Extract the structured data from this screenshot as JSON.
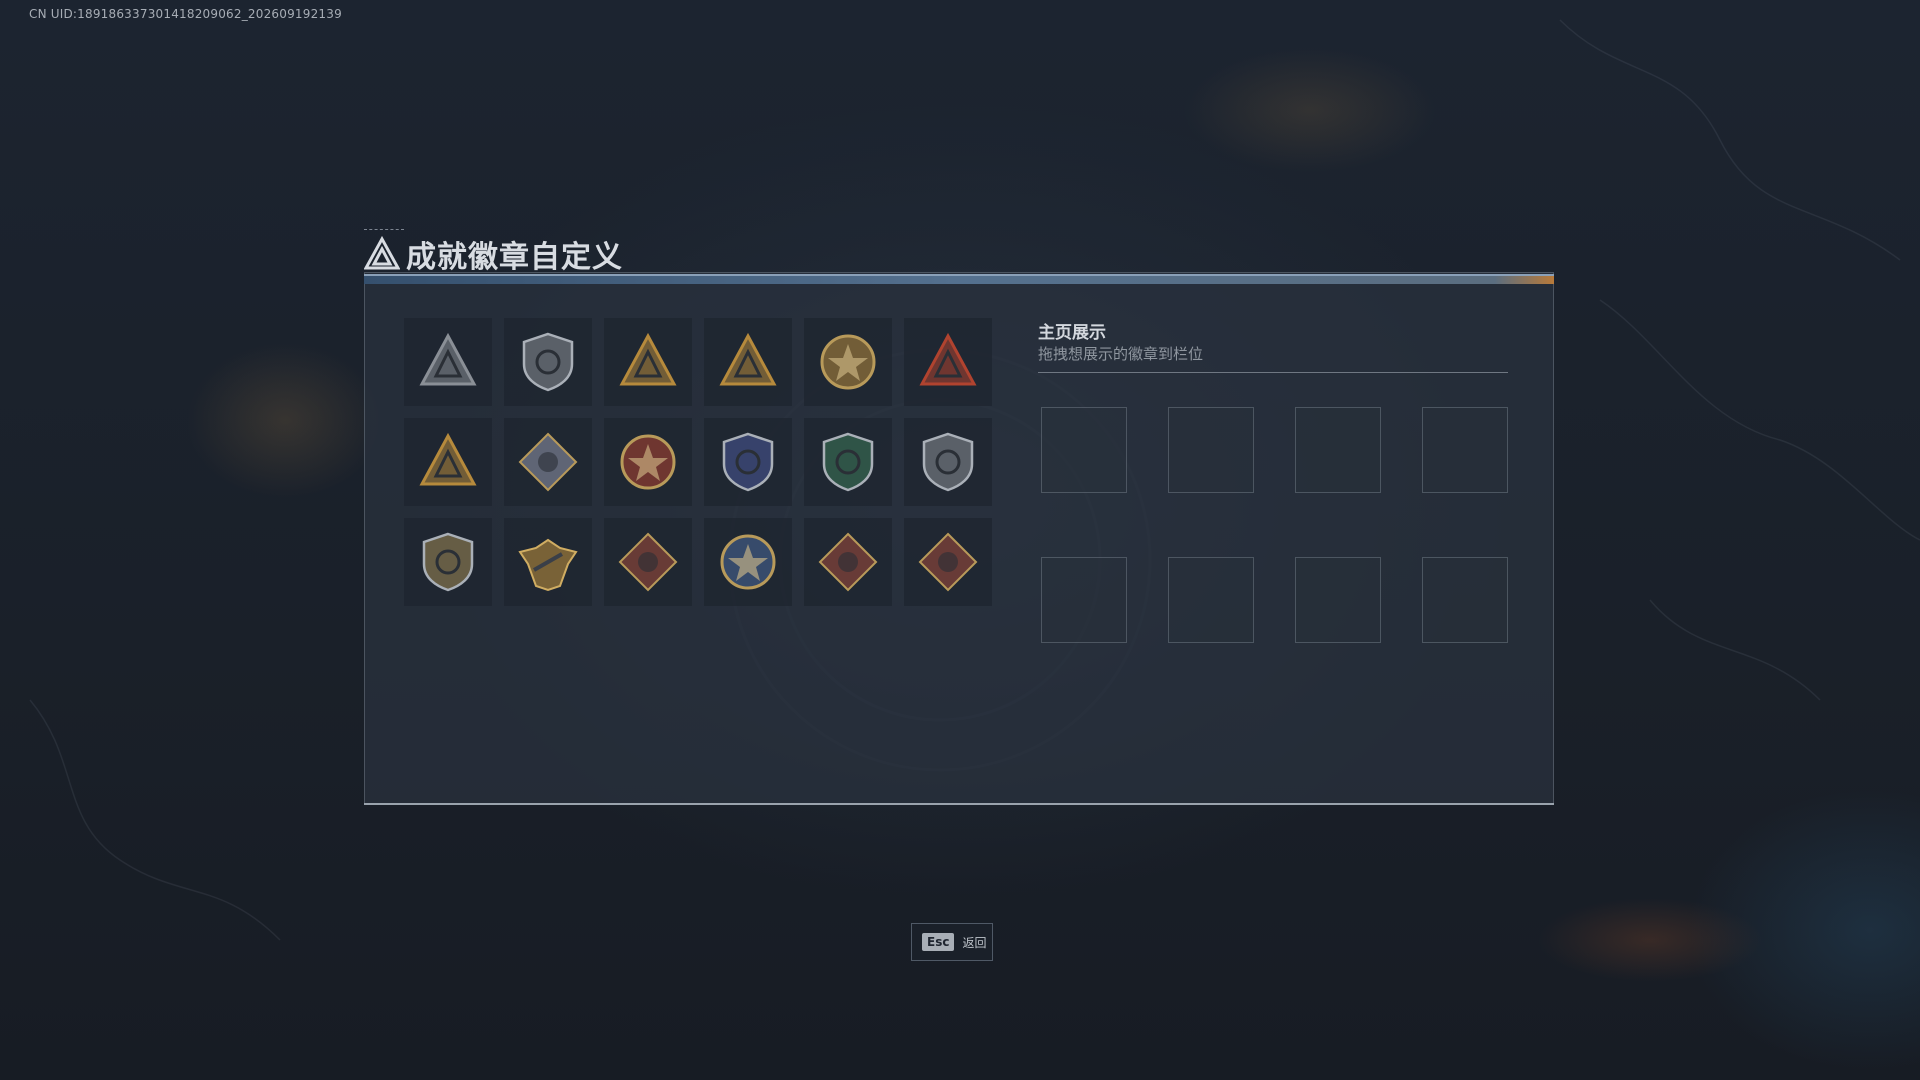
{
  "uid_text": "CN UID:1891863373014182090​62_202609192139",
  "title": "成就徽章自定义",
  "display": {
    "title": "主页展示",
    "subtitle": "拖拽想展示的徽章到栏位",
    "slot_count": 8
  },
  "badges": [
    {
      "icon": "triangle-shield-badge-icon",
      "color": "#8a8f96"
    },
    {
      "icon": "helicopter-badge-icon",
      "color": "#8a8f96"
    },
    {
      "icon": "sb-triangle-badge-icon",
      "color": "#b68a3c"
    },
    {
      "icon": "tower-triangle-badge-icon",
      "color": "#b68a3c"
    },
    {
      "icon": "flower-badge-icon",
      "color": "#b68a3c"
    },
    {
      "icon": "number-2-triangle-badge-icon",
      "color": "#b0432f"
    },
    {
      "icon": "soldiers-triangle-badge-icon",
      "color": "#b68a3c"
    },
    {
      "icon": "diamond-crystal-badge-icon",
      "color": "#8b8fa3"
    },
    {
      "icon": "star-compass-badge-icon",
      "color": "#b0432f"
    },
    {
      "icon": "blue-shield-badge-icon",
      "color": "#4a5a9a"
    },
    {
      "icon": "green-shield-badge-icon",
      "color": "#3c7a5a"
    },
    {
      "icon": "rifle-shield-badge-icon",
      "color": "#8a8f96"
    },
    {
      "icon": "rifle-shield-gold-badge-icon",
      "color": "#a08a56"
    },
    {
      "icon": "eagle-wings-badge-icon",
      "color": "#b68a3c"
    },
    {
      "icon": "wolf-diamond-badge-icon",
      "color": "#9a4a3a"
    },
    {
      "icon": "blue-eagle-round-badge-icon",
      "color": "#4a6a9a"
    },
    {
      "icon": "dragon-diamond-badge-icon",
      "color": "#9a4a3a"
    },
    {
      "icon": "runner-diamond-badge-icon",
      "color": "#9a4a3a"
    }
  ],
  "esc": {
    "key": "Esc",
    "label": "返回"
  }
}
